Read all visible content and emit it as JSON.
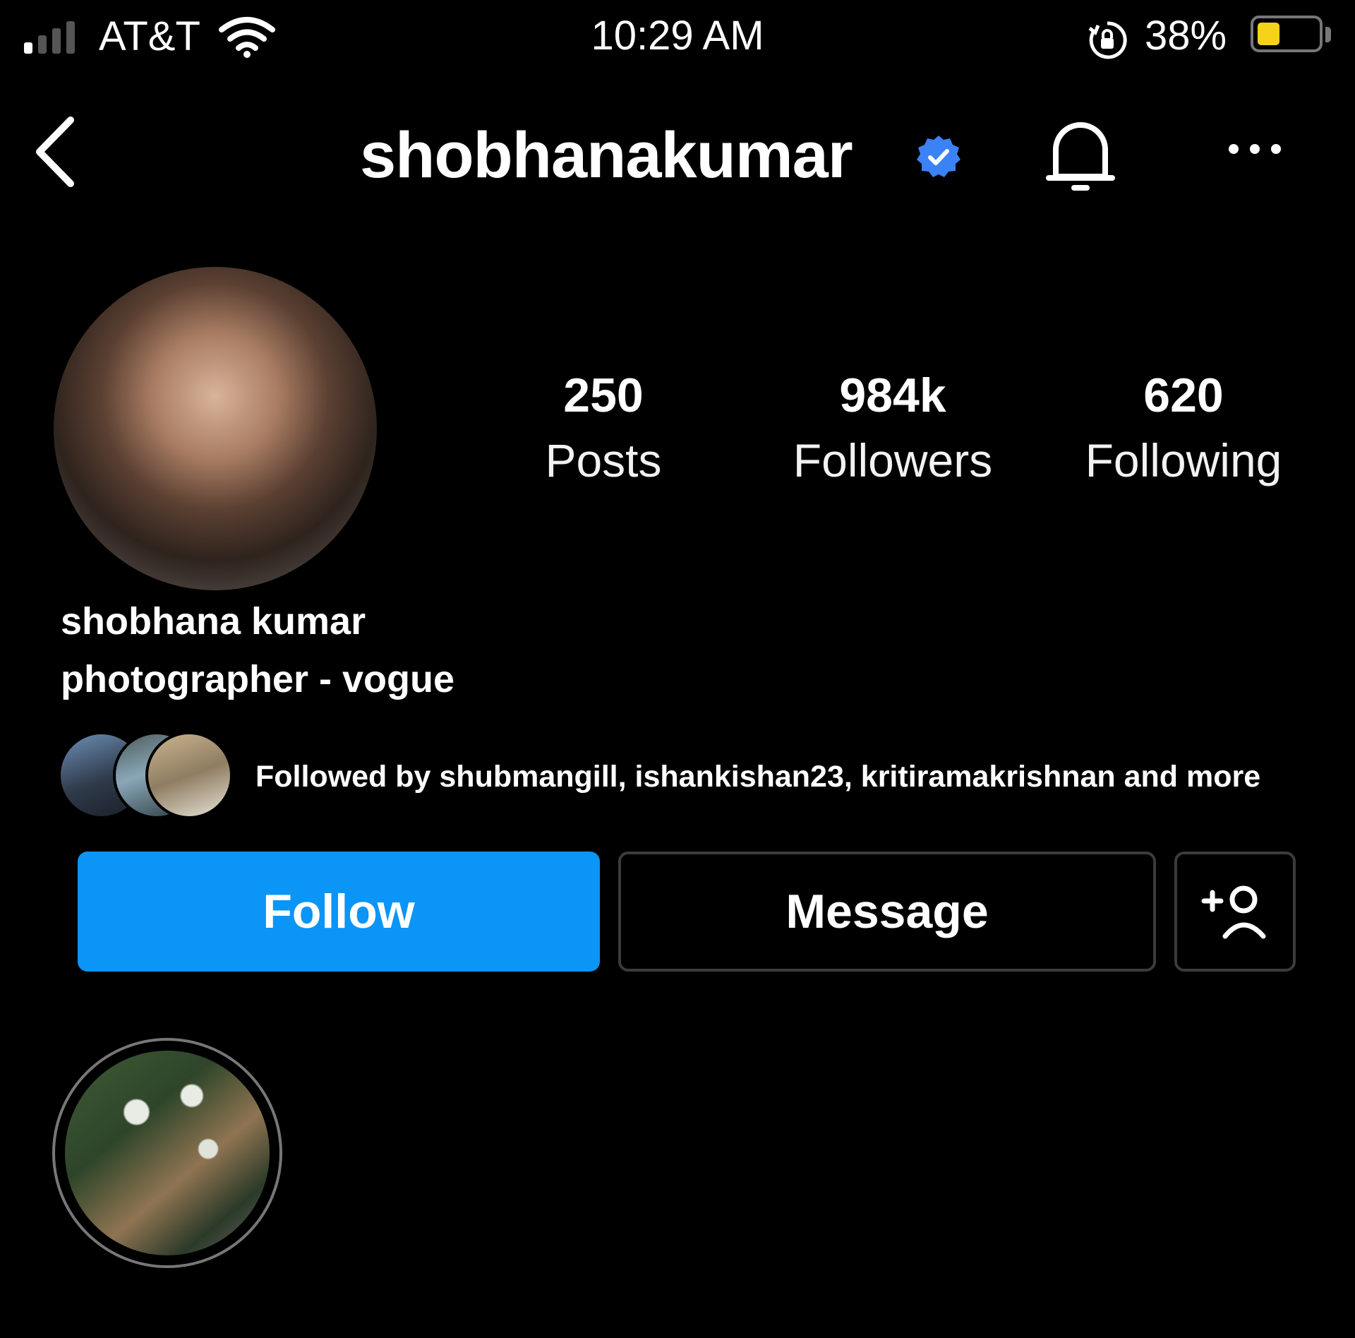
{
  "status_bar": {
    "carrier": "AT&T",
    "time": "10:29 AM",
    "battery_percent": "38%",
    "battery_level": 0.38,
    "battery_color": "#f7d21a",
    "signal_bars_active": 1,
    "icons": [
      "signal-icon",
      "wifi-icon",
      "orientation-lock-icon",
      "battery-icon"
    ]
  },
  "header": {
    "username": "shobhanakumar",
    "verified": true,
    "verified_color": "#3b82f6",
    "icons": [
      "back-arrow-icon",
      "verified-badge-icon",
      "bell-icon",
      "more-options-icon"
    ]
  },
  "stats": [
    {
      "value": "250",
      "label": "Posts"
    },
    {
      "value": "984k",
      "label": "Followers"
    },
    {
      "value": "620",
      "label": "Following"
    }
  ],
  "bio": {
    "name": "shobhana kumar",
    "description": "photographer - vogue"
  },
  "followed_by": {
    "text": "Followed by shubmangill, ishankishan23, kritiramakrishnan and more"
  },
  "actions": {
    "follow_label": "Follow",
    "message_label": "Message",
    "follow_color": "#0b95f6",
    "add_user_icon": "add-user-icon"
  }
}
